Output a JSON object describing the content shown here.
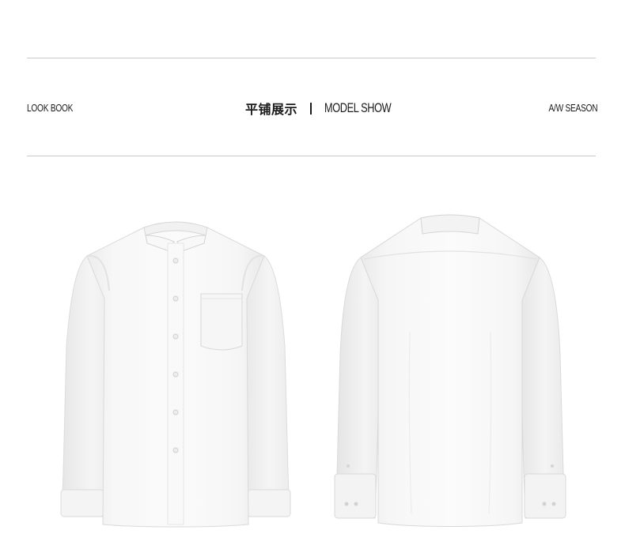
{
  "header": {
    "left_label": "LOOK BOOK",
    "center_cn": "平铺展示",
    "center_en": "MODEL SHOW",
    "right_label": "A/W SEASON"
  },
  "products": [
    {
      "view": "front",
      "icon": "white-shirt-front"
    },
    {
      "view": "back",
      "icon": "white-shirt-back"
    }
  ]
}
